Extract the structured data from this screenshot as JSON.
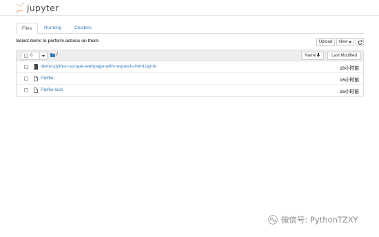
{
  "app": {
    "logo_text": "jupyter"
  },
  "tabs": [
    {
      "label": "Files",
      "active": true
    },
    {
      "label": "Running",
      "active": false
    },
    {
      "label": "Clusters",
      "active": false
    }
  ],
  "toolbar": {
    "hint": "Select items to perform actions on them.",
    "upload_label": "Upload",
    "new_label": "New",
    "refresh_icon": "refresh-icon"
  },
  "list_header": {
    "selected_count": "0",
    "path": "/",
    "name_sort_label": "Name",
    "last_modified_label": "Last Modified"
  },
  "files": [
    {
      "name": "demo-python-scrape-webpage-with-requests-html.ipynb",
      "modified": "16小时前",
      "icon": "notebook-icon"
    },
    {
      "name": "Pipfile",
      "modified": "16小时前",
      "icon": "file-icon"
    },
    {
      "name": "Pipfile.lock",
      "modified": "16小时前",
      "icon": "file-icon"
    }
  ],
  "watermark": {
    "text": "微信号: PythonTZXY"
  },
  "colors": {
    "link": "#337ab7",
    "jupyter_orange": "#f37726",
    "header_bg": "#eeeeee"
  }
}
